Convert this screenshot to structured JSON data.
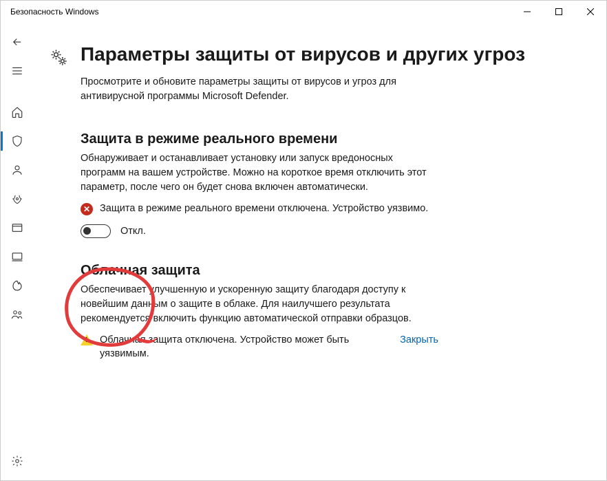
{
  "window": {
    "title": "Безопасность Windows"
  },
  "sidebar": {
    "back": "back",
    "menu": "menu",
    "items": [
      {
        "name": "home",
        "active": false
      },
      {
        "name": "virus-protection",
        "active": true
      },
      {
        "name": "account-protection",
        "active": false
      },
      {
        "name": "firewall",
        "active": false
      },
      {
        "name": "app-browser-control",
        "active": false
      },
      {
        "name": "device-security",
        "active": false
      },
      {
        "name": "device-performance",
        "active": false
      },
      {
        "name": "family-options",
        "active": false
      }
    ],
    "settings": "settings"
  },
  "page": {
    "title": "Параметры защиты от вирусов и других угроз",
    "subtitle": "Просмотрите и обновите параметры защиты от вирусов и угроз для антивирусной программы Microsoft Defender."
  },
  "realtime": {
    "heading": "Защита в режиме реального времени",
    "desc": "Обнаруживает и останавливает установку или запуск вредоносных программ на вашем устройстве. Можно на короткое время отключить этот параметр, после чего он будет снова включен автоматически.",
    "warning": "Защита в режиме реального времени отключена. Устройство уязвимо.",
    "toggle_label": "Откл."
  },
  "cloud": {
    "heading": "Облачная защита",
    "desc": "Обеспечивает улучшенную и ускоренную защиту благодаря доступу к новейшим данным о защите в облаке. Для наилучшего результата рекомендуется включить функцию автоматической отправки образцов.",
    "warning": "Облачная защита отключена. Устройство может быть уязвимым.",
    "dismiss": "Закрыть"
  }
}
